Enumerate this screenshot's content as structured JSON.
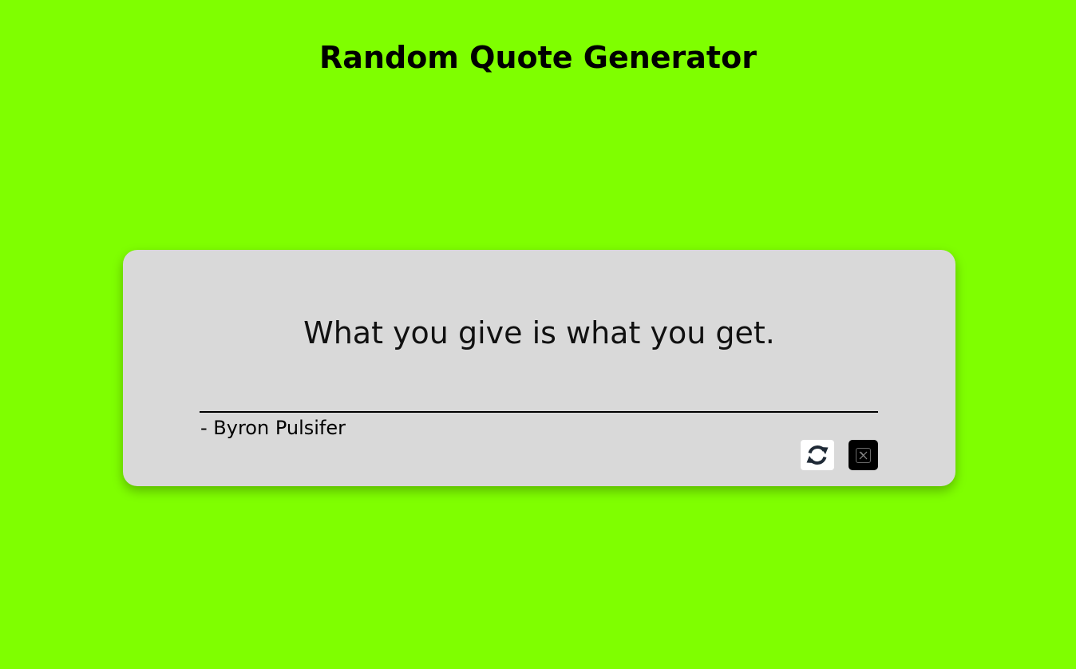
{
  "header": {
    "title": "Random Quote Generator"
  },
  "quote": {
    "text": "What you give is what you get.",
    "author": "- Byron Pulsifer"
  },
  "actions": {
    "new_quote_icon": "refresh-icon",
    "tweet_icon": "x-twitter-icon"
  },
  "colors": {
    "background": "#7fff00",
    "card": "#d9d9d9",
    "tweet_button": "#000000",
    "new_quote_button": "#ffffff"
  }
}
